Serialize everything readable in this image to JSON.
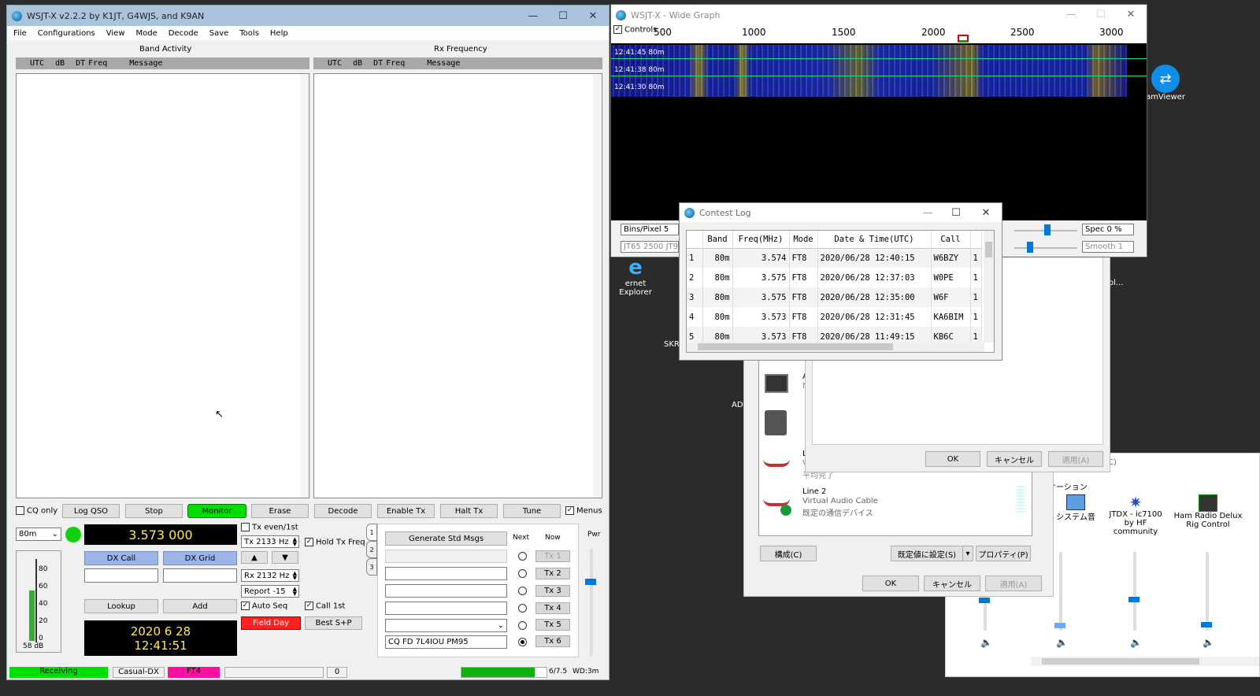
{
  "main": {
    "title": "WSJT-X   v2.2.2   by K1JT, G4WJS, and K9AN",
    "menu": [
      "File",
      "Configurations",
      "View",
      "Mode",
      "Decode",
      "Save",
      "Tools",
      "Help"
    ],
    "band_activity": "Band Activity",
    "rx_frequency": "Rx Frequency",
    "headers": [
      "UTC",
      "dB",
      "DT",
      "Freq",
      "Message"
    ],
    "buttons": {
      "cq_only": "CQ only",
      "log_qso": "Log QSO",
      "stop": "Stop",
      "monitor": "Monitor",
      "erase": "Erase",
      "decode": "Decode",
      "enable_tx": "Enable Tx",
      "halt_tx": "Halt Tx",
      "tune": "Tune",
      "menus": "Menus",
      "dx_call": "DX Call",
      "dx_grid": "DX Grid",
      "lookup": "Lookup",
      "add": "Add",
      "field_day": "Field Day",
      "best_sp": "Best S+P",
      "generate": "Generate Std Msgs"
    },
    "band": "80m",
    "frequency": "3.573 000",
    "date": "2020 6 28",
    "time": "12:41:51",
    "level": "58 dB",
    "meter_ticks": [
      "80",
      "60",
      "40",
      "20",
      "0"
    ],
    "tx_even": "Tx even/1st",
    "tx_freq": "Tx  2133  Hz",
    "hold_tx": "Hold Tx Freq",
    "rx_freq": "Rx  2132  Hz",
    "report": "Report -15",
    "auto_seq": "Auto Seq",
    "call_1st": "Call 1st",
    "next": "Next",
    "now": "Now",
    "pwr": "Pwr",
    "tx_buttons": [
      "Tx 1",
      "Tx 2",
      "Tx 3",
      "Tx 4",
      "Tx 5",
      "Tx 6"
    ],
    "tx6_msg": "CQ FD 7L4IOU PM95",
    "tabs": [
      "1",
      "2",
      "3"
    ],
    "status": {
      "receiving": "Receiving",
      "mode_name": "Casual-DX",
      "mode": "FT4",
      "count": "0",
      "period": "6/7.5",
      "wd": "WD:3m"
    },
    "colors": {
      "monitor": "#00e000",
      "field_day": "#ff2020",
      "receiving": "#00e000",
      "ft4": "#ff10a0",
      "dx": "#9bb5e8"
    }
  },
  "wide": {
    "title": "WSJT-X - Wide Graph",
    "controls": "Controls",
    "scale": [
      "500",
      "1000",
      "1500",
      "2000",
      "2500",
      "3000"
    ],
    "rows": [
      {
        "t": "12:41:45",
        "b": "80m"
      },
      {
        "t": "12:41:38",
        "b": "80m"
      },
      {
        "t": "12:41:30",
        "b": "80m"
      }
    ],
    "bins": "Bins/Pixel  5",
    "jt65": "JT65  2500  JT9",
    "spec": "Spec 0 %",
    "smooth": "Smooth  1"
  },
  "contest": {
    "title": "Contest Log",
    "columns": [
      "Band",
      "Freq(MHz)",
      "Mode",
      "Date & Time(UTC)",
      "Call"
    ],
    "rows": [
      {
        "n": "1",
        "band": "80m",
        "freq": "3.574",
        "mode": "FT8",
        "dt": "2020/06/28 12:40:15",
        "call": "W6BZY",
        "x": "1"
      },
      {
        "n": "2",
        "band": "80m",
        "freq": "3.575",
        "mode": "FT8",
        "dt": "2020/06/28 12:37:03",
        "call": "W0PE",
        "x": "1"
      },
      {
        "n": "3",
        "band": "80m",
        "freq": "3.575",
        "mode": "FT8",
        "dt": "2020/06/28 12:35:00",
        "call": "W6F",
        "x": "1"
      },
      {
        "n": "4",
        "band": "80m",
        "freq": "3.573",
        "mode": "FT8",
        "dt": "2020/06/28 12:31:45",
        "call": "KA6BIM",
        "x": "1"
      },
      {
        "n": "5",
        "band": "80m",
        "freq": "3.573",
        "mode": "FT8",
        "dt": "2020/06/28 11:49:15",
        "call": "KB6C",
        "x": "1"
      }
    ]
  },
  "sound": {
    "device_line2": "Line 2",
    "device_desc": "Virtual Audio Cable",
    "device_default": "既定の通信デバイス",
    "configure": "構成(C)",
    "set_default": "既定値に設定(S)",
    "properties": "プロパティ(P)",
    "ok": "OK",
    "cancel": "キャンセル",
    "apply": "適用(A)",
    "inner_ok": "OK",
    "inner_cancel": "キャンセル",
    "inner_apply": "適用(A)",
    "abbr": [
      "A",
      "N",
      "A",
      "S",
      "L",
      "V",
      "平均完了"
    ]
  },
  "mixer": {
    "section": "ケーション",
    "apps": [
      {
        "name": "システム音"
      },
      {
        "name": "JTDX - ic7100 by HF community"
      },
      {
        "name": "Ham Radio Delux Rig Control"
      }
    ],
    "corner": "C)"
  },
  "desktop": {
    "teamviewer": "amViewer",
    "ie": "ernet Explorer",
    "skr": "SKR",
    "ad": "AD",
    "ol": "ol..."
  }
}
